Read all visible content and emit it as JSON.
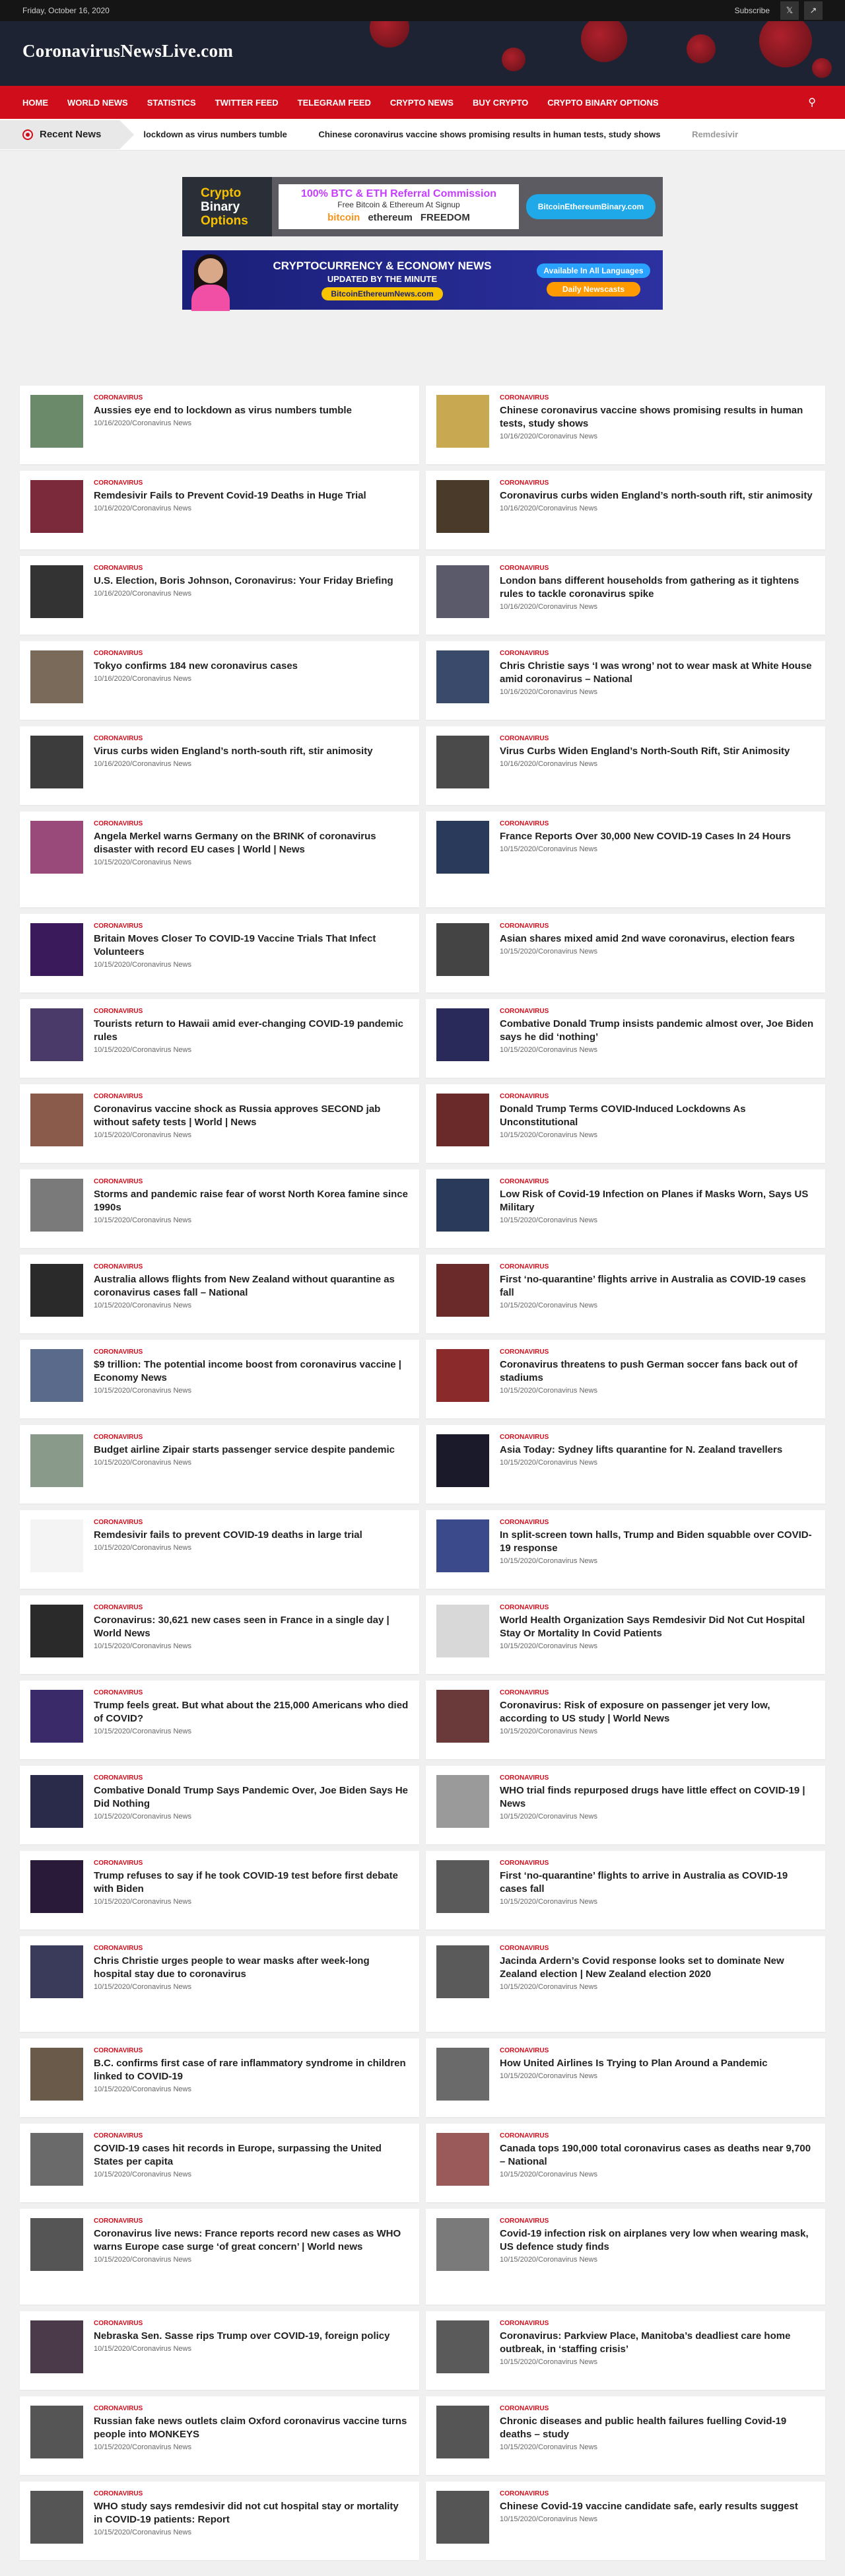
{
  "topbar": {
    "date": "Friday, October 16, 2020",
    "subscribe": "Subscribe"
  },
  "site": {
    "logo": "CoronavirusNewsLive.com"
  },
  "nav": {
    "items": [
      "HOME",
      "WORLD NEWS",
      "STATISTICS",
      "TWITTER FEED",
      "TELEGRAM FEED",
      "CRYPTO NEWS",
      "BUY CRYPTO",
      "CRYPTO BINARY OPTIONS"
    ]
  },
  "ticker": {
    "label": "Recent News",
    "items": [
      "lockdown as virus numbers tumble",
      "Chinese coronavirus vaccine shows promising results in human tests, study shows",
      "Remdesivir"
    ]
  },
  "banner1": {
    "left": [
      "Crypto",
      "Binary",
      "Options"
    ],
    "headline": "100% BTC & ETH Referral Commission",
    "sub": "Free Bitcoin & Ethereum At Signup",
    "coins": [
      "bitcoin",
      "ethereum",
      "FREEDOM"
    ],
    "button": "BitcoinEthereumBinary.com"
  },
  "banner2": {
    "title": "CRYPTOCURRENCY & ECONOMY NEWS",
    "sub": "UPDATED BY THE MINUTE",
    "url": "BitcoinEthereumNews.com",
    "pill1": "Available In All Languages",
    "pill2": "Daily Newscasts"
  },
  "articles": [
    {
      "cat": "CORONAVIRUS",
      "title": "Aussies eye end to lockdown as virus numbers tumble",
      "meta": "10/16/2020/Coronavirus News",
      "color": "#6a8a6a"
    },
    {
      "cat": "CORONAVIRUS",
      "title": "Chinese coronavirus vaccine shows promising results in human tests, study shows",
      "meta": "10/16/2020/Coronavirus News",
      "color": "#c8a850"
    },
    {
      "cat": "CORONAVIRUS",
      "title": "Remdesivir Fails to Prevent Covid-19 Deaths in Huge Trial",
      "meta": "10/16/2020/Coronavirus News",
      "color": "#7a2a3a"
    },
    {
      "cat": "CORONAVIRUS",
      "title": "Coronavirus curbs widen England’s north-south rift, stir animosity",
      "meta": "10/16/2020/Coronavirus News",
      "color": "#4a3a2a"
    },
    {
      "cat": "CORONAVIRUS",
      "title": "U.S. Election, Boris Johnson, Coronavirus: Your Friday Briefing",
      "meta": "10/16/2020/Coronavirus News",
      "color": "#333333"
    },
    {
      "cat": "CORONAVIRUS",
      "title": "London bans different households from gathering as it tightens rules to tackle coronavirus spike",
      "meta": "10/16/2020/Coronavirus News",
      "color": "#5a5a6a"
    },
    {
      "cat": "CORONAVIRUS",
      "title": "Tokyo confirms 184 new coronavirus cases",
      "meta": "10/16/2020/Coronavirus News",
      "color": "#7a6a5a"
    },
    {
      "cat": "CORONAVIRUS",
      "title": "Chris Christie says ‘I was wrong’ not to wear mask at White House amid coronavirus – National",
      "meta": "10/16/2020/Coronavirus News",
      "color": "#3a4a6a"
    },
    {
      "cat": "CORONAVIRUS",
      "title": "Virus curbs widen England’s north-south rift, stir animosity",
      "meta": "10/16/2020/Coronavirus News",
      "color": "#3c3c3c"
    },
    {
      "cat": "CORONAVIRUS",
      "title": "Virus Curbs Widen England’s North-South Rift, Stir Animosity",
      "meta": "10/16/2020/Coronavirus News",
      "color": "#4a4a4a"
    },
    {
      "cat": "CORONAVIRUS",
      "title": "Angela Merkel warns Germany on the BRINK of coronavirus disaster with record EU cases | World | News",
      "meta": "10/15/2020/Coronavirus News",
      "color": "#9a4a7a"
    },
    {
      "cat": "CORONAVIRUS",
      "title": "France Reports Over 30,000 New COVID-19 Cases In 24 Hours",
      "meta": "10/15/2020/Coronavirus News",
      "color": "#2a3a5a"
    },
    {
      "cat": "CORONAVIRUS",
      "title": "Britain Moves Closer To COVID-19 Vaccine Trials That Infect Volunteers",
      "meta": "10/15/2020/Coronavirus News",
      "color": "#3a1a5a"
    },
    {
      "cat": "CORONAVIRUS",
      "title": "Asian shares mixed amid 2nd wave coronavirus, election fears",
      "meta": "10/15/2020/Coronavirus News",
      "color": "#444444"
    },
    {
      "cat": "CORONAVIRUS",
      "title": "Tourists return to Hawaii amid ever-changing COVID-19 pandemic rules",
      "meta": "10/15/2020/Coronavirus News",
      "color": "#4a3a6a"
    },
    {
      "cat": "CORONAVIRUS",
      "title": "Combative Donald Trump insists pandemic almost over, Joe Biden says he did ‘nothing’",
      "meta": "10/15/2020/Coronavirus News",
      "color": "#2a2a5a"
    },
    {
      "cat": "CORONAVIRUS",
      "title": "Coronavirus vaccine shock as Russia approves SECOND jab without safety tests | World | News",
      "meta": "10/15/2020/Coronavirus News",
      "color": "#8a5a4a"
    },
    {
      "cat": "CORONAVIRUS",
      "title": "Donald Trump Terms COVID-Induced Lockdowns As Unconstitutional",
      "meta": "10/15/2020/Coronavirus News",
      "color": "#6a2a2a"
    },
    {
      "cat": "CORONAVIRUS",
      "title": "Storms and pandemic raise fear of worst North Korea famine since 1990s",
      "meta": "10/15/2020/Coronavirus News",
      "color": "#7a7a7a"
    },
    {
      "cat": "CORONAVIRUS",
      "title": "Low Risk of Covid-19 Infection on Planes if Masks Worn, Says US Military",
      "meta": "10/15/2020/Coronavirus News",
      "color": "#2a3a5a"
    },
    {
      "cat": "CORONAVIRUS",
      "title": "Australia allows flights from New Zealand without quarantine as coronavirus cases fall – National",
      "meta": "10/15/2020/Coronavirus News",
      "color": "#2a2a2a"
    },
    {
      "cat": "CORONAVIRUS",
      "title": "First ‘no-quarantine’ flights arrive in Australia as COVID-19 cases fall",
      "meta": "10/15/2020/Coronavirus News",
      "color": "#6a2a2a"
    },
    {
      "cat": "CORONAVIRUS",
      "title": "$9 trillion: The potential income boost from coronavirus vaccine | Economy News",
      "meta": "10/15/2020/Coronavirus News",
      "color": "#5a6a8a"
    },
    {
      "cat": "CORONAVIRUS",
      "title": "Coronavirus threatens to push German soccer fans back out of stadiums",
      "meta": "10/15/2020/Coronavirus News",
      "color": "#8a2a2a"
    },
    {
      "cat": "CORONAVIRUS",
      "title": "Budget airline Zipair starts passenger service despite pandemic",
      "meta": "10/15/2020/Coronavirus News",
      "color": "#8a9a8a"
    },
    {
      "cat": "CORONAVIRUS",
      "title": "Asia Today: Sydney lifts quarantine for N. Zealand travellers",
      "meta": "10/15/2020/Coronavirus News",
      "color": "#1a1a2a"
    },
    {
      "cat": "CORONAVIRUS",
      "title": "Remdesivir fails to prevent COVID-19 deaths in large trial",
      "meta": "10/15/2020/Coronavirus News",
      "color": "#f4f4f4"
    },
    {
      "cat": "CORONAVIRUS",
      "title": "In split-screen town halls, Trump and Biden squabble over COVID-19 response",
      "meta": "10/15/2020/Coronavirus News",
      "color": "#3a4a8a"
    },
    {
      "cat": "CORONAVIRUS",
      "title": "Coronavirus: 30,621 new cases seen in France in a single day | World News",
      "meta": "10/15/2020/Coronavirus News",
      "color": "#2a2a2a"
    },
    {
      "cat": "CORONAVIRUS",
      "title": "World Health Organization Says Remdesivir Did Not Cut Hospital Stay Or Mortality In Covid Patients",
      "meta": "10/15/2020/Coronavirus News",
      "color": "#d8d8d8"
    },
    {
      "cat": "CORONAVIRUS",
      "title": "Trump feels great. But what about the 215,000 Americans who died of COVID?",
      "meta": "10/15/2020/Coronavirus News",
      "color": "#3a2a6a"
    },
    {
      "cat": "CORONAVIRUS",
      "title": "Coronavirus: Risk of exposure on passenger jet very low, according to US study | World News",
      "meta": "10/15/2020/Coronavirus News",
      "color": "#6a3a3a"
    },
    {
      "cat": "CORONAVIRUS",
      "title": "Combative Donald Trump Says Pandemic Over, Joe Biden Says He Did Nothing",
      "meta": "10/15/2020/Coronavirus News",
      "color": "#2a2a4a"
    },
    {
      "cat": "CORONAVIRUS",
      "title": "WHO trial finds repurposed drugs have little effect on COVID-19 | News",
      "meta": "10/15/2020/Coronavirus News",
      "color": "#9a9a9a"
    },
    {
      "cat": "CORONAVIRUS",
      "title": "Trump refuses to say if he took COVID-19 test before first debate with Biden",
      "meta": "10/15/2020/Coronavirus News",
      "color": "#2a1a3a"
    },
    {
      "cat": "CORONAVIRUS",
      "title": "First ‘no-quarantine’ flights to arrive in Australia as COVID-19 cases fall",
      "meta": "10/15/2020/Coronavirus News",
      "color": "#5a5a5a"
    },
    {
      "cat": "CORONAVIRUS",
      "title": "Chris Christie urges people to wear masks after week-long hospital stay due to coronavirus",
      "meta": "10/15/2020/Coronavirus News",
      "color": "#3a3a5a"
    },
    {
      "cat": "CORONAVIRUS",
      "title": "Jacinda Ardern’s Covid response looks set to dominate New Zealand election | New Zealand election 2020",
      "meta": "10/15/2020/Coronavirus News",
      "color": "#5a5a5a"
    },
    {
      "cat": "CORONAVIRUS",
      "title": "B.C. confirms first case of rare inflammatory syndrome in children linked to COVID-19",
      "meta": "10/15/2020/Coronavirus News",
      "color": "#6a5a4a"
    },
    {
      "cat": "CORONAVIRUS",
      "title": "How United Airlines Is Trying to Plan Around a Pandemic",
      "meta": "10/15/2020/Coronavirus News",
      "color": "#6a6a6a"
    },
    {
      "cat": "CORONAVIRUS",
      "title": "COVID-19 cases hit records in Europe, surpassing the United States per capita",
      "meta": "10/15/2020/Coronavirus News",
      "color": "#6a6a6a"
    },
    {
      "cat": "CORONAVIRUS",
      "title": "Canada tops 190,000 total coronavirus cases as deaths near 9,700 – National",
      "meta": "10/15/2020/Coronavirus News",
      "color": "#9a5a5a"
    },
    {
      "cat": "CORONAVIRUS",
      "title": "Coronavirus live news: France reports record new cases as WHO warns Europe case surge ‘of great concern’ | World news",
      "meta": "10/15/2020/Coronavirus News",
      "color": "#555555"
    },
    {
      "cat": "CORONAVIRUS",
      "title": "Covid-19 infection risk on airplanes very low when wearing mask, US defence study finds",
      "meta": "10/15/2020/Coronavirus News",
      "color": "#7a7a7a"
    },
    {
      "cat": "CORONAVIRUS",
      "title": "Nebraska Sen. Sasse rips Trump over COVID-19, foreign policy",
      "meta": "10/15/2020/Coronavirus News",
      "color": "#4a3a4a"
    },
    {
      "cat": "CORONAVIRUS",
      "title": "Coronavirus: Parkview Place, Manitoba’s deadliest care home outbreak, in ‘staffing crisis’",
      "meta": "10/15/2020/Coronavirus News",
      "color": "#5a5a5a"
    },
    {
      "cat": "CORONAVIRUS",
      "title": "Russian fake news outlets claim Oxford coronavirus vaccine turns people into MONKEYS",
      "meta": "10/15/2020/Coronavirus News",
      "color": "#555555"
    },
    {
      "cat": "CORONAVIRUS",
      "title": "Chronic diseases and public health failures fuelling Covid-19 deaths – study",
      "meta": "10/15/2020/Coronavirus News",
      "color": "#555555"
    },
    {
      "cat": "CORONAVIRUS",
      "title": "WHO study says remdesivir did not cut hospital stay or mortality in COVID-19 patients: Report",
      "meta": "10/15/2020/Coronavirus News",
      "color": "#555555"
    },
    {
      "cat": "CORONAVIRUS",
      "title": "Chinese Covid-19 vaccine candidate safe, early results suggest",
      "meta": "10/15/2020/Coronavirus News",
      "color": "#555555"
    }
  ]
}
